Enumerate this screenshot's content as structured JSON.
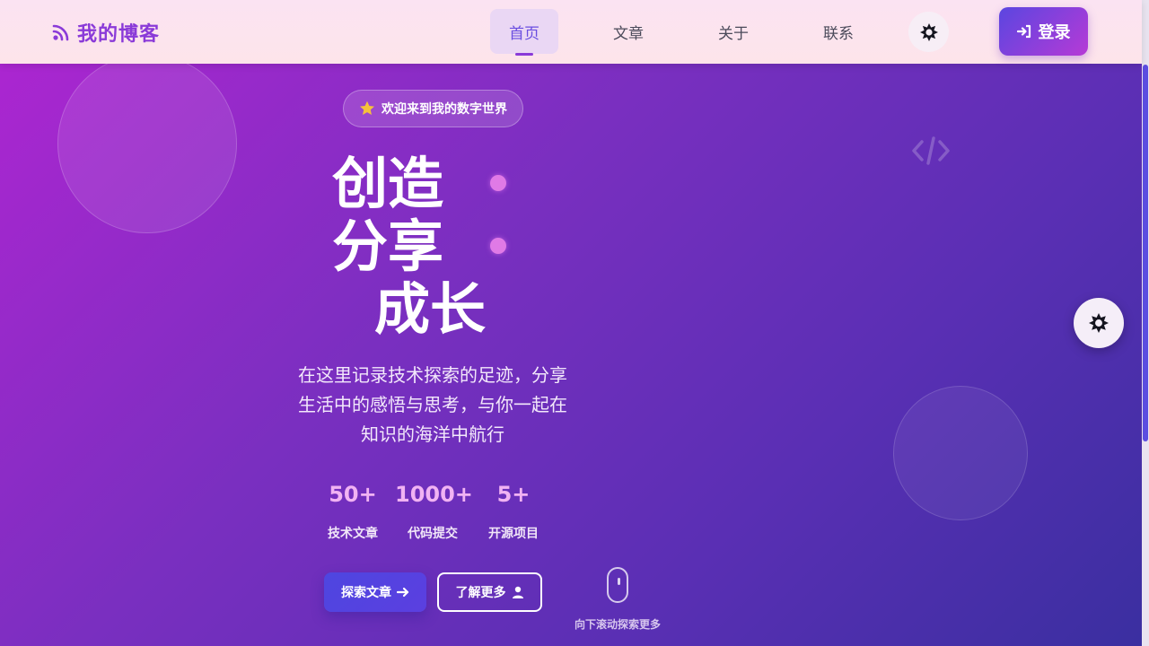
{
  "header": {
    "logo_text": "我的博客",
    "logo_icon": "rss-icon",
    "nav": [
      {
        "label": "首页",
        "active": true
      },
      {
        "label": "文章",
        "active": false
      },
      {
        "label": "关于",
        "active": false
      },
      {
        "label": "联系",
        "active": false
      }
    ],
    "theme_icon": "sun-icon",
    "login_label": "登录",
    "login_icon": "sign-in-icon"
  },
  "hero": {
    "welcome_badge": "欢迎来到我的数字世界",
    "welcome_icon": "star-icon",
    "headline": [
      "创造",
      "分享",
      "成长"
    ],
    "subtitle_lines": [
      "在这里记录技术探索的足迹，分享",
      "生活中的感悟与思考，与你一起在",
      "知识的海洋中航行"
    ],
    "stats": [
      {
        "value": "50+",
        "label": "技术文章"
      },
      {
        "value": "1000+",
        "label": "代码提交"
      },
      {
        "value": "5+",
        "label": "开源项目"
      }
    ],
    "explore_button": "探索文章",
    "more_button": "了解更多",
    "scroll_hint": "向下滚动探索更多"
  },
  "colors": {
    "accent": "#8a3ad8",
    "nav_active": "#6a4ee0",
    "stat_value": "#f1b3f3",
    "button_primary": "#4e46e0"
  },
  "floating_settings_icon": "gear-icon",
  "decor_icon": "code-icon"
}
